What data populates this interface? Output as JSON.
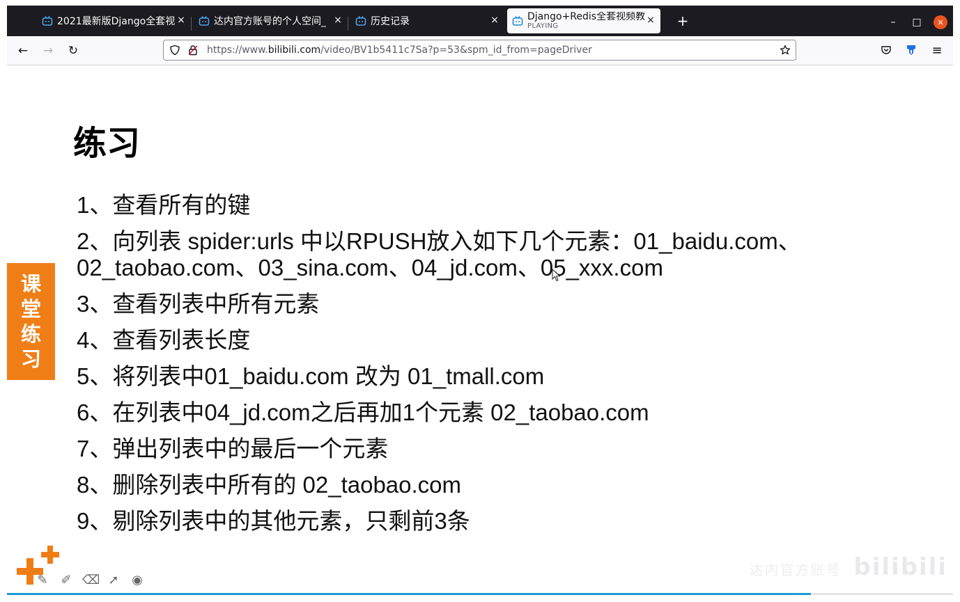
{
  "tabs": [
    {
      "title": "2021最新版Django全套视",
      "active": false
    },
    {
      "title": "达内官方账号的个人空间_",
      "active": false
    },
    {
      "title": "历史记录",
      "active": false
    },
    {
      "title": "Django+Redis全套视频教",
      "subtitle": "PLAYING",
      "active": true
    }
  ],
  "tab_close_glyph": "×",
  "new_tab_glyph": "+",
  "window_controls": {
    "minimize": "–",
    "maximize": "□",
    "close": "×"
  },
  "nav": {
    "back": "←",
    "forward": "→",
    "reload": "↻"
  },
  "urlbar": {
    "prefix": "https://www.",
    "host": "bilibili.com",
    "path": "/video/BV1b5411c7Sa?p=53&spm_id_from=pageDriver"
  },
  "toolbar_right": {
    "menu": "≡"
  },
  "slide": {
    "title": "练习",
    "side_badge": [
      "课",
      "堂",
      "练",
      "习"
    ],
    "exercises": [
      "1、查看所有的键",
      "2、向列表 spider:urls 中以RPUSH放入如下几个元素：01_baidu.com、02_taobao.com、03_sina.com、04_jd.com、05_xxx.com",
      "3、查看列表中所有元素",
      "4、查看列表长度",
      "5、将列表中01_baidu.com 改为 01_tmall.com",
      "6、在列表中04_jd.com之后再加1个元素 02_taobao.com",
      "7、弹出列表中的最后一个元素",
      "8、删除列表中所有的 02_taobao.com",
      "9、剔除列表中的其他元素，只剩前3条"
    ],
    "watermark_left": "达内官方账号",
    "watermark_brand": "bilibili"
  },
  "video_progress": 0.85,
  "colors": {
    "titlebar": "#1c1b22",
    "navbar": "#f9f9fb",
    "badge": "#f07e16",
    "progress": "#1a9bd6",
    "close_button": "#e95420"
  },
  "icons": {
    "tab_icon": "bilibili-tv-icon",
    "shield": "shield-icon",
    "lock": "lock-icon",
    "bookmark": "star-icon",
    "pocket": "pocket-icon",
    "extension": "extension-icon",
    "menu": "hamburger-menu-icon"
  }
}
